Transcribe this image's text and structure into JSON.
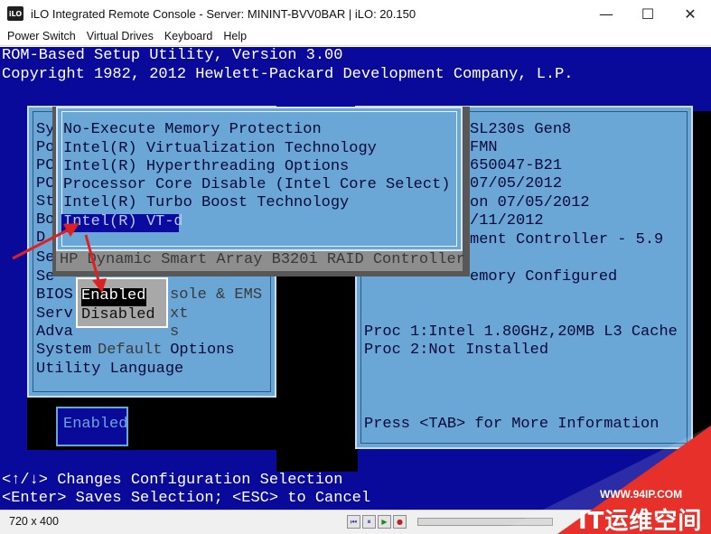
{
  "window": {
    "icon_text": "iLO",
    "title": "iLO Integrated Remote Console - Server: MININT-BVV0BAR | iLO: 20.150",
    "min_glyph": "—",
    "max_glyph": "☐",
    "close_glyph": "✕"
  },
  "menubar": {
    "items": [
      "Power Switch",
      "Virtual Drives",
      "Keyboard",
      "Help"
    ]
  },
  "console": {
    "header": {
      "line1": "ROM-Based Setup Utility, Version 3.00",
      "line2": "Copyright 1982, 2012 Hewlett-Packard Development Company, L.P."
    },
    "main_menu": {
      "items": [
        "Sy",
        "Po",
        "PC",
        "PC",
        "St",
        "Bo",
        "D",
        "Se",
        "Se",
        "BIOS",
        "Serv",
        "Adva",
        "System",
        "Utility Language"
      ],
      "partial_text": {
        "hp": "HP",
        "bios_rest": "sole & EMS",
        "serv_rest": "xt",
        "adva_rest": "s",
        "system_rest": " Default Options",
        "system_highlight": "Default",
        "system_rest2": " Options"
      }
    },
    "advanced_submenu": {
      "items": [
        "No-Execute Memory Protection",
        "Intel(R) Virtualization Technology",
        "Intel(R) Hyperthreading Options",
        "Processor Core Disable (Intel Core Select)",
        "Intel(R) Turbo Boost Technology",
        "Intel(R) VT-d"
      ],
      "selected_index": 5,
      "below_item": "HP Dynamic Smart Array B320i RAID Controller"
    },
    "popup": {
      "options": [
        "Enabled",
        "Disabled"
      ],
      "selected": "Enabled"
    },
    "current_value": "Enabled",
    "info_panel": {
      "lines": [
        "SL230s Gen8",
        "FMN",
        "650047-B21",
        "07/05/2012",
        "on 07/05/2012",
        "/11/2012",
        "ment Controller - 5.9",
        "",
        "emory Configured"
      ],
      "proc1": "Proc 1:Intel 1.80GHz,20MB L3 Cache",
      "proc2": "Proc 2:Not Installed",
      "more": "Press <TAB> for More Information"
    },
    "status": {
      "line1": "<↑/↓> Changes Configuration Selection",
      "line2": "<Enter> Saves Selection; <ESC> to Cancel"
    }
  },
  "bottom_strip": {
    "resolution": "720 x 400"
  },
  "watermark": {
    "url": "WWW.94IP.COM",
    "name": "IT运维空间"
  },
  "colors": {
    "console_bg": "#0a0a9a",
    "panel": "#6aa6d6",
    "highlight": "#000000",
    "annotation_arrow": "#e02020"
  }
}
